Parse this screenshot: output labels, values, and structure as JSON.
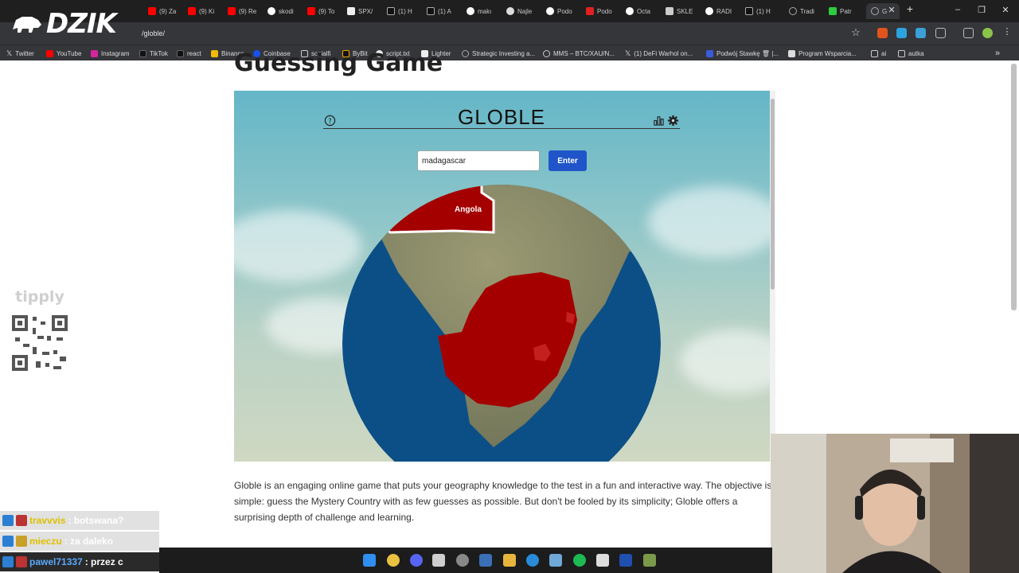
{
  "browser": {
    "tabs": [
      {
        "label": "(9) Za",
        "color": "#ff0000"
      },
      {
        "label": "(9) Ki",
        "color": "#ff0000"
      },
      {
        "label": "(9) Re",
        "color": "#ff0000"
      },
      {
        "label": "skodi",
        "color": "#ffffff"
      },
      {
        "label": "(9) To",
        "color": "#ff0000"
      },
      {
        "label": "SPX/",
        "color": "#ffffff"
      },
      {
        "label": "(1) H",
        "color": "#ffffff"
      },
      {
        "label": "(1) A",
        "color": "#ffffff"
      },
      {
        "label": "makı",
        "color": "#ffffff"
      },
      {
        "label": "Najle",
        "color": "#ffffff"
      },
      {
        "label": "Podo",
        "color": "#ffffff"
      },
      {
        "label": "Podo",
        "color": "#e02020"
      },
      {
        "label": "Octa",
        "color": "#ffffff"
      },
      {
        "label": "SKLE",
        "color": "#ffffff"
      },
      {
        "label": "RADI",
        "color": "#ffffff"
      },
      {
        "label": "(1) H",
        "color": "#ffffff"
      },
      {
        "label": "Tradi",
        "color": "#ffffff"
      },
      {
        "label": "Patr",
        "color": "#2ecc40"
      },
      {
        "label": "G",
        "color": "#ffffff"
      }
    ],
    "url": "/globle/",
    "bookmarks": [
      "Twitter",
      "YouTube",
      "Instagram",
      "TikTok",
      "react",
      "Binance",
      "Coinbase",
      "socialfi",
      "ByBit",
      "script.txt",
      "Lighter",
      "Strategic Investing a...",
      "MMS – BTC/XAU/N...",
      "(1) DeFi Warhol on...",
      "Podwój Stawkę 🗑 |...",
      "Program Wsparcia...",
      "ai",
      "autka"
    ]
  },
  "overlay": {
    "logo_text": "DZIK",
    "tipply_brand": "tipply",
    "chat": [
      {
        "user": "travvvis",
        "message": ": botswana?",
        "user_color": "#e0c000"
      },
      {
        "user": "mieczu",
        "message": ": za daleko",
        "user_color": "#e0c000"
      },
      {
        "user": "pawel71337",
        "message": ": przez c",
        "user_color": "#5aa9ff"
      }
    ]
  },
  "page": {
    "heading": "Guessing Game",
    "game": {
      "title": "GLOBLE",
      "input_value": "madagascar",
      "enter_label": "Enter",
      "country_label": "Angola",
      "colors": {
        "guessed": "#a50000",
        "ocean": "#0b4f86",
        "land": "#8b8a63"
      }
    },
    "description": "Globle is an engaging online game that puts your geography knowledge to the test in a fun and interactive way. The objective is simple: guess the Mystery Country with as few guesses as possible. But don't be fooled by its simplicity; Globle offers a surprising depth of challenge and learning."
  }
}
